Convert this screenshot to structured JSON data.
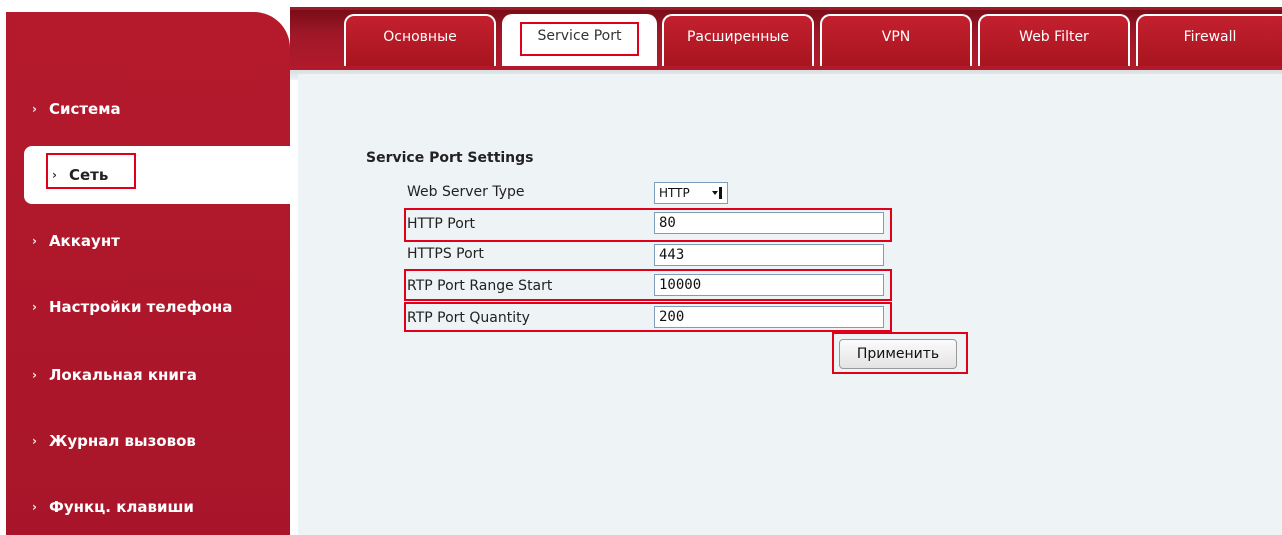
{
  "tabs": [
    {
      "label": "Основные"
    },
    {
      "label": "Service Port"
    },
    {
      "label": "Расширенные"
    },
    {
      "label": "VPN"
    },
    {
      "label": "Web Filter"
    },
    {
      "label": "Firewall"
    }
  ],
  "active_tab": "Service Port",
  "sidebar": {
    "items": [
      {
        "label": "Система"
      },
      {
        "label": "Сеть"
      },
      {
        "label": "Аккаунт"
      },
      {
        "label": "Настройки телефона"
      },
      {
        "label": "Локальная книга"
      },
      {
        "label": "Журнал вызовов"
      },
      {
        "label": "Функц. клавиши"
      }
    ],
    "active_item": "Сеть",
    "chevron": "›"
  },
  "form": {
    "section_title": "Service Port Settings",
    "web_server_type": {
      "label": "Web Server Type",
      "value": "HTTP"
    },
    "http_port": {
      "label": "HTTP Port",
      "value": "80"
    },
    "https_port": {
      "label": "HTTPS Port",
      "value": "443"
    },
    "rtp_port_range_start": {
      "label": "RTP Port Range Start",
      "value": "10000"
    },
    "rtp_port_quantity": {
      "label": "RTP Port Quantity",
      "value": "200"
    },
    "apply_label": "Применить"
  },
  "colors": {
    "brand_red": "#b51a2c",
    "highlight_red": "#e0001a",
    "content_bg": "#eef3f6"
  }
}
